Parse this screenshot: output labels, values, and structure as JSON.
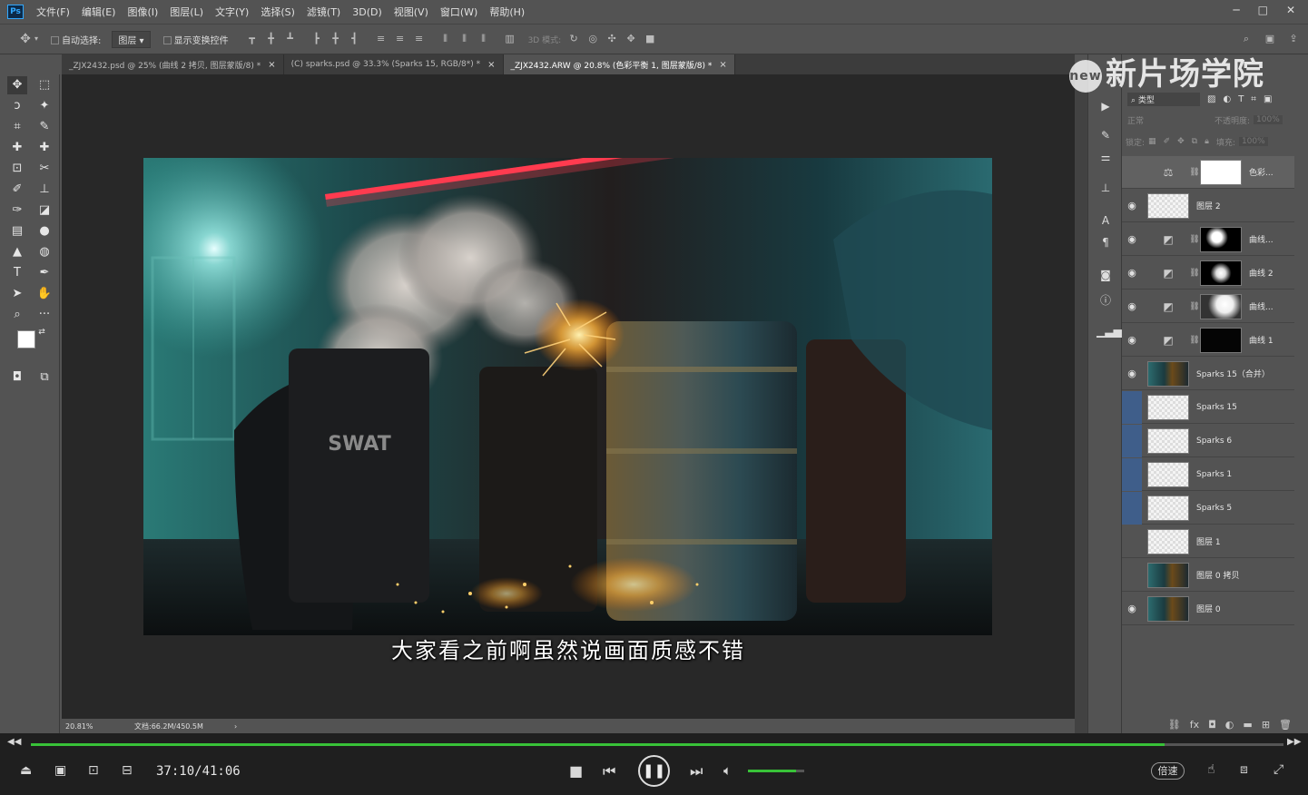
{
  "menu": {
    "logo": "Ps",
    "items": [
      "文件(F)",
      "编辑(E)",
      "图像(I)",
      "图层(L)",
      "文字(Y)",
      "选择(S)",
      "滤镜(T)",
      "3D(D)",
      "视图(V)",
      "窗口(W)",
      "帮助(H)"
    ]
  },
  "options": {
    "auto_select_label": "自动选择:",
    "auto_select_value": "图层",
    "show_transform_label": "显示变换控件",
    "mode_3d_label": "3D 模式:"
  },
  "tabs": [
    {
      "label": "_ZJX2432.psd @ 25% (曲线 2 拷贝, 图层蒙版/8) *",
      "close": "×"
    },
    {
      "label": "(C) sparks.psd @ 33.3% (Sparks 15, RGB/8*) *",
      "close": "×"
    },
    {
      "label": "_ZJX2432.ARW @ 20.8% (色彩平衡 1, 图层蒙版/8) *",
      "close": "×"
    }
  ],
  "canvas": {
    "subtitle": "大家看之前啊虽然说画面质感不错",
    "shield_text": "SWAT"
  },
  "status": {
    "zoom": "20.81%",
    "doc": "文档:66.2M/450.5M"
  },
  "watermark": {
    "badge": "new",
    "text": "新片场学院"
  },
  "layers_panel": {
    "filter_label": "类型",
    "blend_mode": "正常",
    "opacity_label": "不透明度:",
    "opacity_value": "100%",
    "lock_label": "锁定:",
    "fill_label": "填充:",
    "fill_value": "100%",
    "layers": [
      {
        "name": "色彩...",
        "type": "adjust-mask-white",
        "visible": false,
        "selected": true
      },
      {
        "name": "图层 2",
        "type": "pixel",
        "visible": true
      },
      {
        "name": "曲线...",
        "type": "curve-mask",
        "visible": true
      },
      {
        "name": "曲线 2",
        "type": "curve-mask",
        "visible": true
      },
      {
        "name": "曲线...",
        "type": "curve-mask",
        "visible": true
      },
      {
        "name": "曲线 1",
        "type": "curve-mask",
        "visible": true
      },
      {
        "name": "Sparks 15（合并）",
        "type": "photo",
        "visible": true
      },
      {
        "name": "Sparks 15",
        "type": "pixel",
        "visible": false,
        "linked": true
      },
      {
        "name": "Sparks 6",
        "type": "pixel",
        "visible": false,
        "linked": true
      },
      {
        "name": "Sparks 1",
        "type": "pixel",
        "visible": false,
        "linked": true
      },
      {
        "name": "Sparks 5",
        "type": "pixel",
        "visible": false,
        "linked": true
      },
      {
        "name": "图层 1",
        "type": "pixel",
        "visible": false
      },
      {
        "name": "图层 0 拷贝",
        "type": "photo",
        "visible": false
      },
      {
        "name": "图层 0",
        "type": "photo",
        "visible": true
      }
    ]
  },
  "player": {
    "time": "37:10/41:06",
    "progress": 0.905,
    "volume": 0.85,
    "speed_label": "倍速"
  },
  "colors": {
    "accent": "#38c238",
    "panel": "#535353",
    "canvas_bg": "#282828"
  }
}
